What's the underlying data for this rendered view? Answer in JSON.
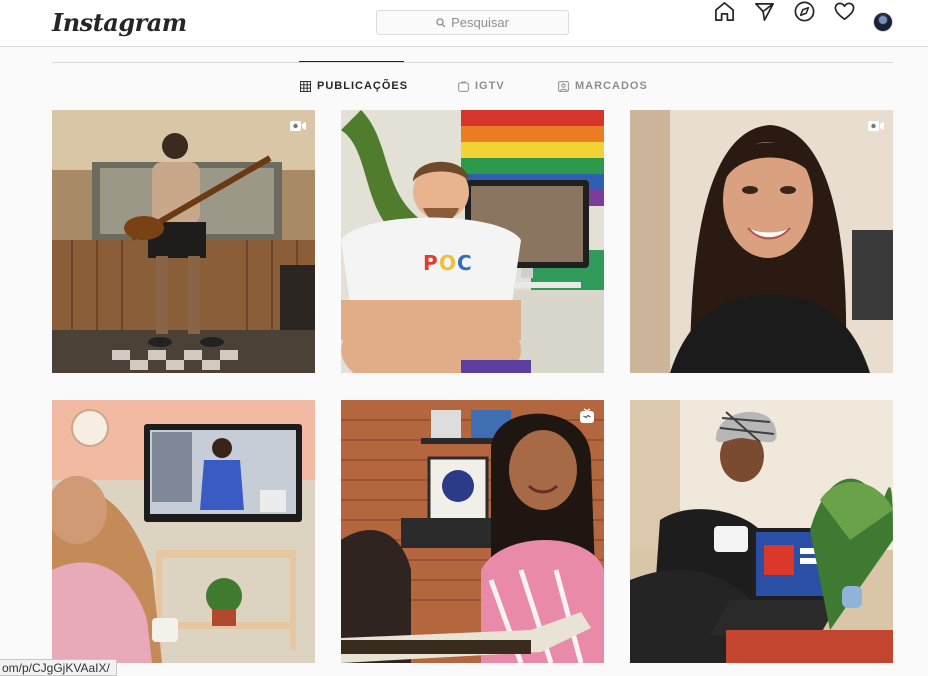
{
  "header": {
    "logo": "Instagram",
    "search_placeholder": "Pesquisar",
    "icons": [
      "home-icon",
      "direct-icon",
      "explore-icon",
      "activity-heart-icon",
      "profile-avatar"
    ]
  },
  "tabs": [
    {
      "label": "PUBLICAÇÕES",
      "icon": "grid-icon",
      "active": true
    },
    {
      "label": "IGTV",
      "icon": "igtv-icon",
      "active": false
    },
    {
      "label": "MARCADOS",
      "icon": "tagged-icon",
      "active": false
    }
  ],
  "posts": [
    {
      "type": "video",
      "badge": "video-camera-icon"
    },
    {
      "type": "image",
      "badge": ""
    },
    {
      "type": "video",
      "badge": "video-camera-icon"
    },
    {
      "type": "image",
      "badge": ""
    },
    {
      "type": "igtv",
      "badge": "igtv-badge-icon"
    },
    {
      "type": "image",
      "badge": ""
    }
  ],
  "status_bar": {
    "url": "om/p/CJgGjKVAaIX/"
  },
  "colors": {
    "border": "#dbdbdb",
    "text": "#262626",
    "muted": "#8e8e8e",
    "background": "#fafafa"
  }
}
